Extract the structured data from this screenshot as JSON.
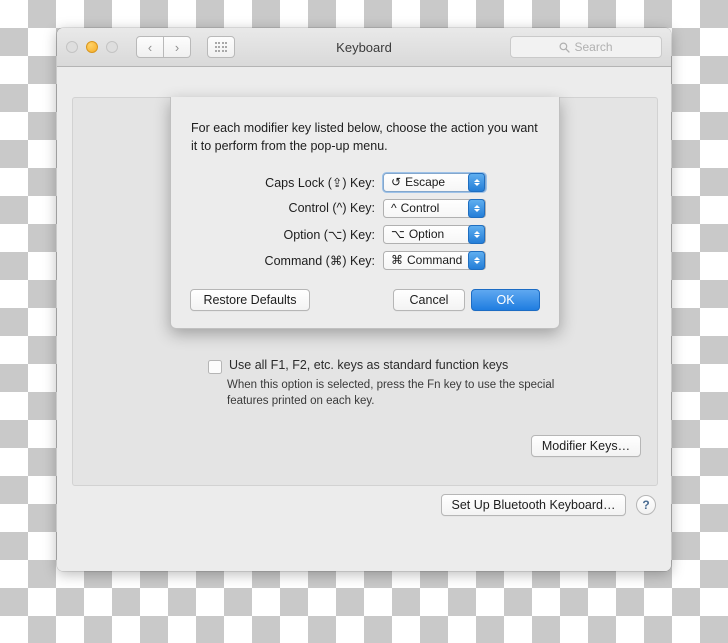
{
  "window": {
    "title": "Keyboard",
    "traffic_lights": [
      "close-button",
      "minimize-button",
      "zoom-button"
    ],
    "nav": {
      "back_label": "‹",
      "forward_label": "›"
    },
    "grid_button": "show-all-button",
    "search": {
      "placeholder": "Search",
      "value": "",
      "icon": "search-icon"
    }
  },
  "pane": {
    "function_keys": {
      "checked": false,
      "label": "Use all F1, F2, etc. keys as standard function keys",
      "description": "When this option is selected, press the Fn key to use the special features printed on each key."
    },
    "modifier_keys_button": "Modifier Keys…",
    "bluetooth_button": "Set Up Bluetooth Keyboard…",
    "help_button": "?"
  },
  "sheet": {
    "intro": "For each modifier key listed below, choose the action you want it to perform from the pop-up menu.",
    "rows": [
      {
        "label": "Caps Lock (⇪) Key:",
        "glyph": "↺",
        "value": "Escape",
        "focused": true
      },
      {
        "label": "Control (^) Key:",
        "glyph": "^",
        "value": "Control",
        "focused": false
      },
      {
        "label": "Option (⌥) Key:",
        "glyph": "⌥",
        "value": "Option",
        "focused": false
      },
      {
        "label": "Command (⌘) Key:",
        "glyph": "⌘",
        "value": "Command",
        "focused": false
      }
    ],
    "restore_label": "Restore Defaults",
    "cancel_label": "Cancel",
    "ok_label": "OK"
  },
  "colors": {
    "accent_blue": "#2d80dc",
    "minimize_yellow": "#f6ae29",
    "window_gray": "#ececec",
    "panel_gray": "#e4e4e4"
  }
}
